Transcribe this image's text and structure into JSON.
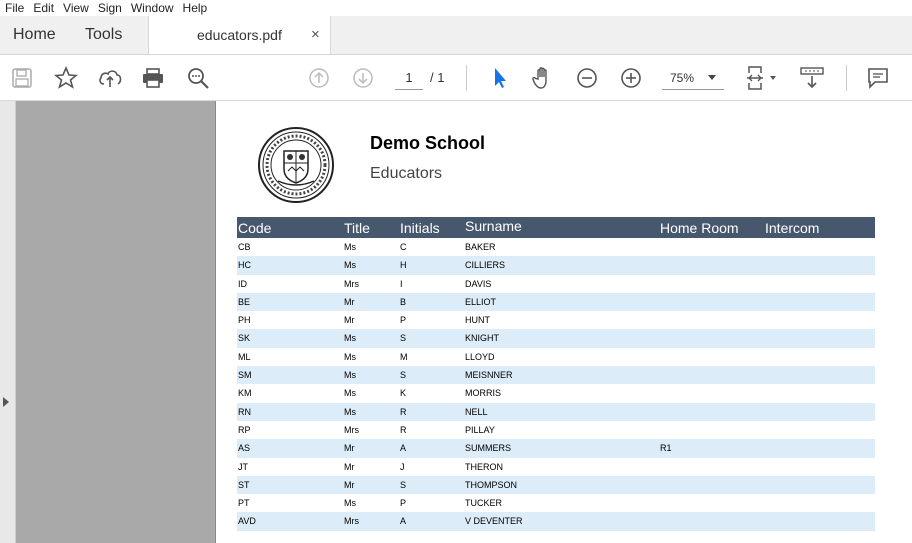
{
  "menu": [
    "File",
    "Edit",
    "View",
    "Sign",
    "Window",
    "Help"
  ],
  "tabs": {
    "home": "Home",
    "tools": "Tools",
    "document": "educators.pdf",
    "close": "×"
  },
  "toolbar": {
    "page_current": "1",
    "page_total": "/ 1",
    "zoom": "75%",
    "icons": [
      "save-icon",
      "bookmark-star-icon",
      "upload-cloud-icon",
      "print-icon",
      "search-zoom-icon",
      "page-up-icon",
      "page-down-icon",
      "select-cursor-icon",
      "hand-pan-icon",
      "zoom-out-icon",
      "zoom-in-icon",
      "fit-page-icon",
      "scroll-mode-icon",
      "comment-icon"
    ],
    "accent": "#1473e6"
  },
  "document": {
    "school": "Demo School",
    "subtitle": "Educators",
    "header_color": "#47586e",
    "stripe_color": "#dcecf8",
    "columns": [
      "Code",
      "Title",
      "Initials",
      "Surname",
      "Home Room",
      "Intercom"
    ],
    "rows": [
      [
        "CB",
        "Ms",
        "C",
        "BAKER",
        "",
        ""
      ],
      [
        "HC",
        "Ms",
        "H",
        "CILLIERS",
        "",
        ""
      ],
      [
        "ID",
        "Mrs",
        "I",
        "DAVIS",
        "",
        ""
      ],
      [
        "BE",
        "Mr",
        "B",
        "ELLIOT",
        "",
        ""
      ],
      [
        "PH",
        "Mr",
        "P",
        "HUNT",
        "",
        ""
      ],
      [
        "SK",
        "Ms",
        "S",
        "KNIGHT",
        "",
        ""
      ],
      [
        "ML",
        "Ms",
        "M",
        "LLOYD",
        "",
        ""
      ],
      [
        "SM",
        "Ms",
        "S",
        "MEISNNER",
        "",
        ""
      ],
      [
        "KM",
        "Ms",
        "K",
        "MORRIS",
        "",
        ""
      ],
      [
        "RN",
        "Ms",
        "R",
        "NELL",
        "",
        ""
      ],
      [
        "RP",
        "Mrs",
        "R",
        "PILLAY",
        "",
        ""
      ],
      [
        "AS",
        "Mr",
        "A",
        "SUMMERS",
        "R1",
        ""
      ],
      [
        "JT",
        "Mr",
        "J",
        "THERON",
        "",
        ""
      ],
      [
        "ST",
        "Mr",
        "S",
        "THOMPSON",
        "",
        ""
      ],
      [
        "PT",
        "Ms",
        "P",
        "TUCKER",
        "",
        ""
      ],
      [
        "AVD",
        "Mrs",
        "A",
        "V DEVENTER",
        "",
        ""
      ]
    ]
  }
}
